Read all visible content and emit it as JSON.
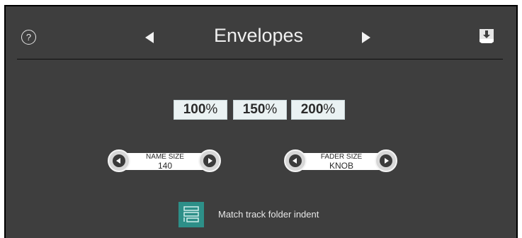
{
  "header": {
    "help_label": "?",
    "title": "Envelopes"
  },
  "scale_buttons": [
    {
      "number": "100",
      "suffix": "%"
    },
    {
      "number": "150",
      "suffix": "%"
    },
    {
      "number": "200",
      "suffix": "%"
    }
  ],
  "name_size": {
    "label": "NAME SIZE",
    "value": "140"
  },
  "fader_size": {
    "label": "FADER SIZE",
    "value": "KNOB"
  },
  "match_folder": {
    "label": "Match track folder indent"
  },
  "icons": {
    "help": "help-icon",
    "prev": "prev-arrow-icon",
    "next": "next-arrow-icon",
    "save": "save-download-icon",
    "toggle": "folder-indent-icon"
  },
  "colors": {
    "panel_bg": "#3e3e3e",
    "accent": "#2d8f88",
    "scale_button_bg": "#eaf2f3"
  }
}
